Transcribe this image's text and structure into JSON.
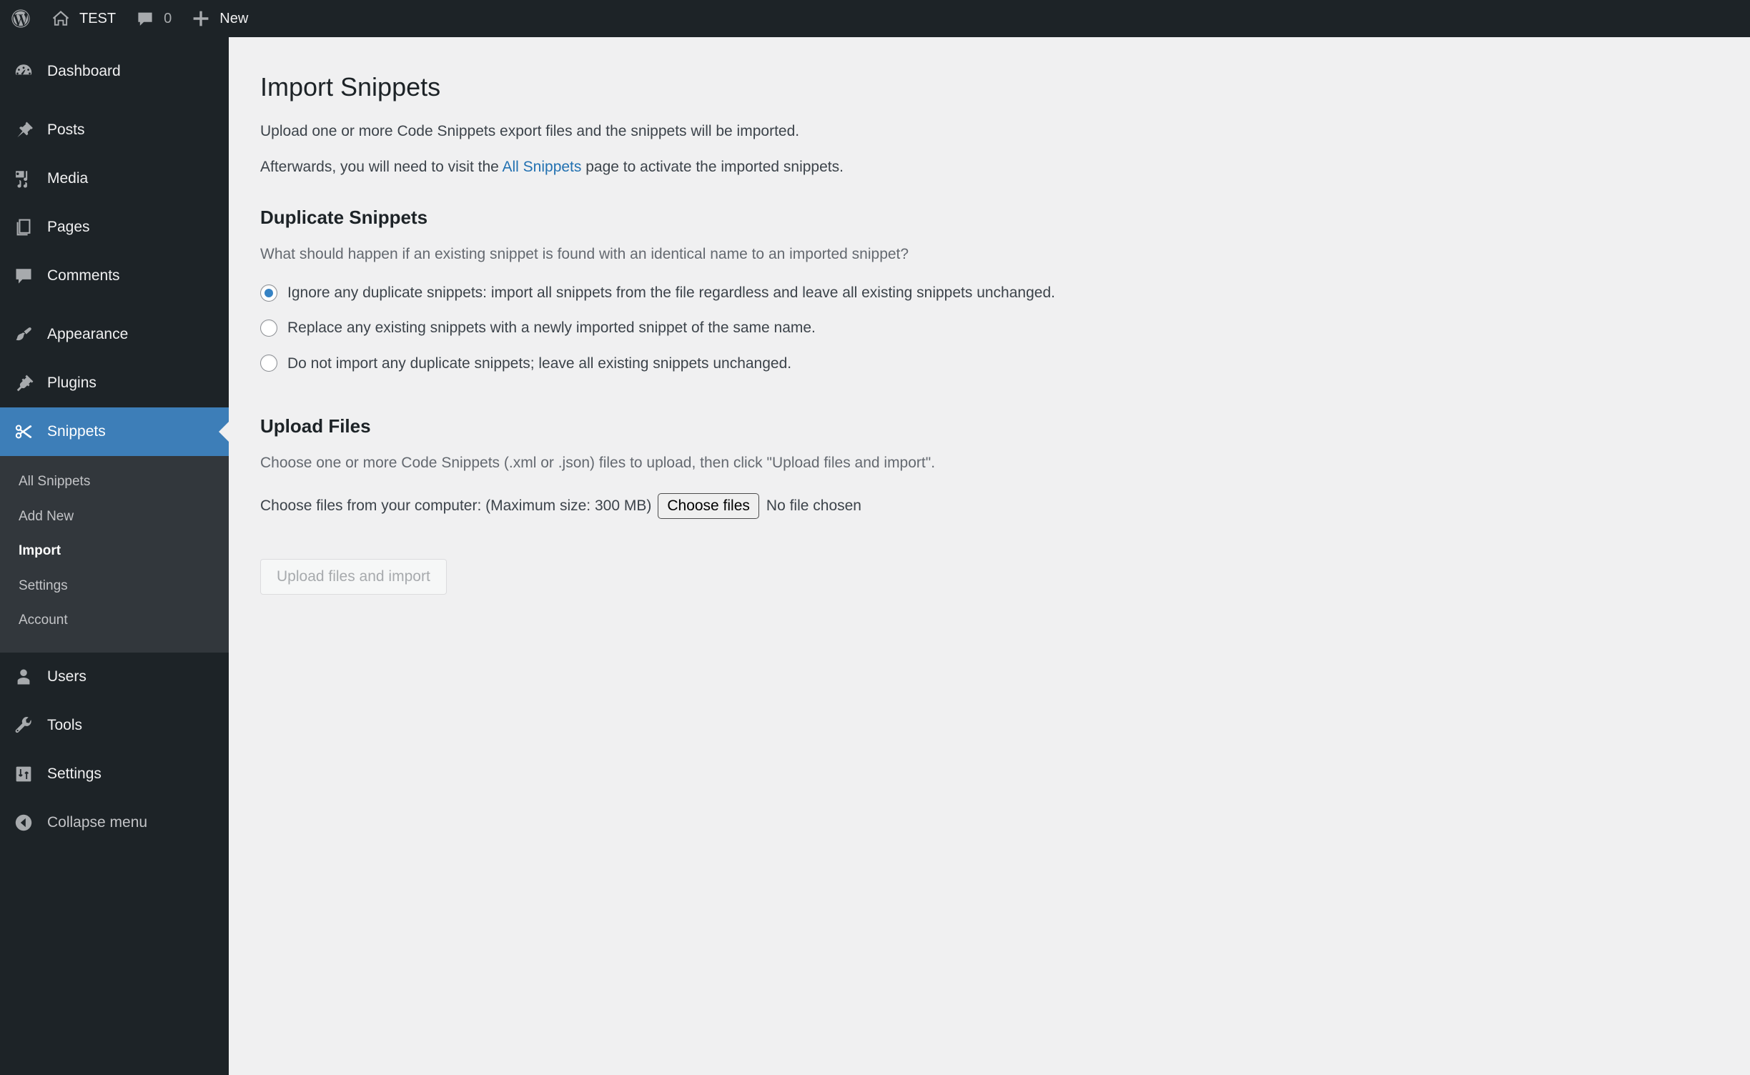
{
  "adminbar": {
    "items": [
      {
        "icon": "wordpress-logo-icon",
        "label": ""
      },
      {
        "icon": "home-icon",
        "label": "TEST"
      },
      {
        "icon": "comment-bubble-icon",
        "label": "0"
      },
      {
        "icon": "plus-icon",
        "label": "New"
      }
    ],
    "site_name": "TEST",
    "comment_count": "0",
    "new_label": "New"
  },
  "sidebar": {
    "items": [
      {
        "label": "Dashboard",
        "icon": "dashboard-gauge-icon",
        "current": false
      },
      {
        "label": "Posts",
        "icon": "pin-icon",
        "current": false
      },
      {
        "label": "Media",
        "icon": "media-icon",
        "current": false
      },
      {
        "label": "Pages",
        "icon": "pages-icon",
        "current": false
      },
      {
        "label": "Comments",
        "icon": "comment-bubble-icon",
        "current": false
      },
      {
        "label": "Appearance",
        "icon": "paintbrush-icon",
        "current": false
      },
      {
        "label": "Plugins",
        "icon": "plug-icon",
        "current": false
      },
      {
        "label": "Snippets",
        "icon": "scissors-icon",
        "current": true
      },
      {
        "label": "Users",
        "icon": "user-icon",
        "current": false
      },
      {
        "label": "Tools",
        "icon": "wrench-icon",
        "current": false
      },
      {
        "label": "Settings",
        "icon": "sliders-icon",
        "current": false
      }
    ],
    "submenu": [
      {
        "label": "All Snippets",
        "current": false
      },
      {
        "label": "Add New",
        "current": false
      },
      {
        "label": "Import",
        "current": true
      },
      {
        "label": "Settings",
        "current": false
      },
      {
        "label": "Account",
        "current": false
      }
    ],
    "collapse": {
      "label": "Collapse menu",
      "icon": "collapse-arrow-icon"
    }
  },
  "main": {
    "title": "Import Snippets",
    "intro": "Upload one or more Code Snippets export files and the snippets will be imported.",
    "afterwards_prefix": "Afterwards, you will need to visit the ",
    "afterwards_link": "All Snippets",
    "afterwards_suffix": " page to activate the imported snippets.",
    "duplicate": {
      "heading": "Duplicate Snippets",
      "description": "What should happen if an existing snippet is found with an identical name to an imported snippet?",
      "options": [
        {
          "label": "Ignore any duplicate snippets: import all snippets from the file regardless and leave all existing snippets unchanged.",
          "checked": true
        },
        {
          "label": "Replace any existing snippets with a newly imported snippet of the same name.",
          "checked": false
        },
        {
          "label": "Do not import any duplicate snippets; leave all existing snippets unchanged.",
          "checked": false
        }
      ]
    },
    "upload": {
      "heading": "Upload Files",
      "description": "Choose one or more Code Snippets (.xml or .json) files to upload, then click \"Upload files and import\".",
      "file_label": "Choose files from your computer: (Maximum size: 300 MB)",
      "choose_button": "Choose files",
      "file_status": "No file chosen",
      "submit_button": "Upload files and import"
    }
  },
  "colors": {
    "adminbar_bg": "#1d2327",
    "sidebar_bg": "#1d2327",
    "submenu_bg": "#32373c",
    "current_menu_bg": "#3d7eb8",
    "content_bg": "#f0f0f1",
    "link": "#2271b1",
    "radio_accent": "#3582c4"
  }
}
